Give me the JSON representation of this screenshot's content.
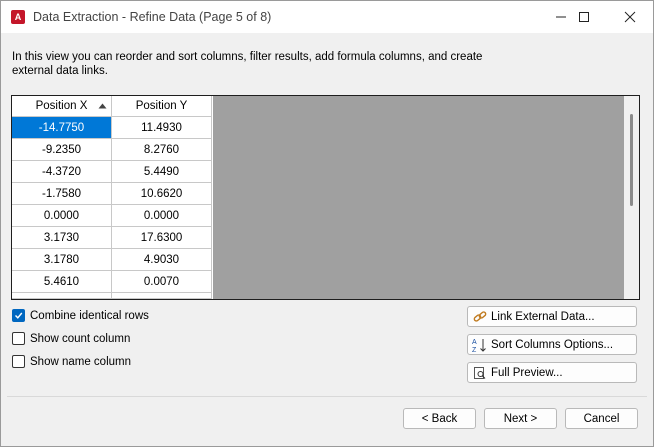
{
  "window": {
    "title": "Data Extraction - Refine Data (Page 5 of 8)"
  },
  "instructions": "In this view you can reorder and sort columns, filter results, add formula columns, and create external data links.",
  "grid": {
    "columns": [
      "Position X",
      "Position Y"
    ],
    "sorted_column": "Position X",
    "sort_direction": "ascending",
    "rows": [
      [
        "-14.7750",
        "11.4930"
      ],
      [
        "-9.2350",
        "8.2760"
      ],
      [
        "-4.3720",
        "5.4490"
      ],
      [
        "-1.7580",
        "10.6620"
      ],
      [
        "0.0000",
        "0.0000"
      ],
      [
        "3.1730",
        "17.6300"
      ],
      [
        "3.1780",
        "4.9030"
      ],
      [
        "5.4610",
        "0.0070"
      ]
    ],
    "selected_row": 0
  },
  "options": {
    "combine_identical_rows": {
      "label": "Combine identical rows",
      "checked": true
    },
    "show_count_column": {
      "label": "Show count column",
      "checked": false
    },
    "show_name_column": {
      "label": "Show name column",
      "checked": false
    }
  },
  "side_buttons": {
    "link_external_data": "Link External Data...",
    "sort_columns_options": "Sort Columns Options...",
    "full_preview": "Full Preview..."
  },
  "nav": {
    "back": "< Back",
    "next": "Next >",
    "cancel": "Cancel"
  },
  "colors": {
    "selection": "#0078d7",
    "app_icon": "#c4162a",
    "checkbox_checked": "#0067c0"
  }
}
